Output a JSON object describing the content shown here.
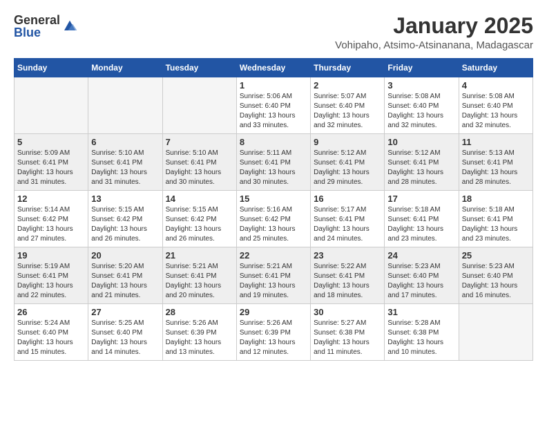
{
  "logo": {
    "general": "General",
    "blue": "Blue"
  },
  "title": "January 2025",
  "location": "Vohipaho, Atsimo-Atsinanana, Madagascar",
  "weekdays": [
    "Sunday",
    "Monday",
    "Tuesday",
    "Wednesday",
    "Thursday",
    "Friday",
    "Saturday"
  ],
  "weeks": [
    [
      {
        "day": "",
        "info": ""
      },
      {
        "day": "",
        "info": ""
      },
      {
        "day": "",
        "info": ""
      },
      {
        "day": "1",
        "info": "Sunrise: 5:06 AM\nSunset: 6:40 PM\nDaylight: 13 hours\nand 33 minutes."
      },
      {
        "day": "2",
        "info": "Sunrise: 5:07 AM\nSunset: 6:40 PM\nDaylight: 13 hours\nand 32 minutes."
      },
      {
        "day": "3",
        "info": "Sunrise: 5:08 AM\nSunset: 6:40 PM\nDaylight: 13 hours\nand 32 minutes."
      },
      {
        "day": "4",
        "info": "Sunrise: 5:08 AM\nSunset: 6:40 PM\nDaylight: 13 hours\nand 32 minutes."
      }
    ],
    [
      {
        "day": "5",
        "info": "Sunrise: 5:09 AM\nSunset: 6:41 PM\nDaylight: 13 hours\nand 31 minutes."
      },
      {
        "day": "6",
        "info": "Sunrise: 5:10 AM\nSunset: 6:41 PM\nDaylight: 13 hours\nand 31 minutes."
      },
      {
        "day": "7",
        "info": "Sunrise: 5:10 AM\nSunset: 6:41 PM\nDaylight: 13 hours\nand 30 minutes."
      },
      {
        "day": "8",
        "info": "Sunrise: 5:11 AM\nSunset: 6:41 PM\nDaylight: 13 hours\nand 30 minutes."
      },
      {
        "day": "9",
        "info": "Sunrise: 5:12 AM\nSunset: 6:41 PM\nDaylight: 13 hours\nand 29 minutes."
      },
      {
        "day": "10",
        "info": "Sunrise: 5:12 AM\nSunset: 6:41 PM\nDaylight: 13 hours\nand 28 minutes."
      },
      {
        "day": "11",
        "info": "Sunrise: 5:13 AM\nSunset: 6:41 PM\nDaylight: 13 hours\nand 28 minutes."
      }
    ],
    [
      {
        "day": "12",
        "info": "Sunrise: 5:14 AM\nSunset: 6:42 PM\nDaylight: 13 hours\nand 27 minutes."
      },
      {
        "day": "13",
        "info": "Sunrise: 5:15 AM\nSunset: 6:42 PM\nDaylight: 13 hours\nand 26 minutes."
      },
      {
        "day": "14",
        "info": "Sunrise: 5:15 AM\nSunset: 6:42 PM\nDaylight: 13 hours\nand 26 minutes."
      },
      {
        "day": "15",
        "info": "Sunrise: 5:16 AM\nSunset: 6:42 PM\nDaylight: 13 hours\nand 25 minutes."
      },
      {
        "day": "16",
        "info": "Sunrise: 5:17 AM\nSunset: 6:41 PM\nDaylight: 13 hours\nand 24 minutes."
      },
      {
        "day": "17",
        "info": "Sunrise: 5:18 AM\nSunset: 6:41 PM\nDaylight: 13 hours\nand 23 minutes."
      },
      {
        "day": "18",
        "info": "Sunrise: 5:18 AM\nSunset: 6:41 PM\nDaylight: 13 hours\nand 23 minutes."
      }
    ],
    [
      {
        "day": "19",
        "info": "Sunrise: 5:19 AM\nSunset: 6:41 PM\nDaylight: 13 hours\nand 22 minutes."
      },
      {
        "day": "20",
        "info": "Sunrise: 5:20 AM\nSunset: 6:41 PM\nDaylight: 13 hours\nand 21 minutes."
      },
      {
        "day": "21",
        "info": "Sunrise: 5:21 AM\nSunset: 6:41 PM\nDaylight: 13 hours\nand 20 minutes."
      },
      {
        "day": "22",
        "info": "Sunrise: 5:21 AM\nSunset: 6:41 PM\nDaylight: 13 hours\nand 19 minutes."
      },
      {
        "day": "23",
        "info": "Sunrise: 5:22 AM\nSunset: 6:41 PM\nDaylight: 13 hours\nand 18 minutes."
      },
      {
        "day": "24",
        "info": "Sunrise: 5:23 AM\nSunset: 6:40 PM\nDaylight: 13 hours\nand 17 minutes."
      },
      {
        "day": "25",
        "info": "Sunrise: 5:23 AM\nSunset: 6:40 PM\nDaylight: 13 hours\nand 16 minutes."
      }
    ],
    [
      {
        "day": "26",
        "info": "Sunrise: 5:24 AM\nSunset: 6:40 PM\nDaylight: 13 hours\nand 15 minutes."
      },
      {
        "day": "27",
        "info": "Sunrise: 5:25 AM\nSunset: 6:40 PM\nDaylight: 13 hours\nand 14 minutes."
      },
      {
        "day": "28",
        "info": "Sunrise: 5:26 AM\nSunset: 6:39 PM\nDaylight: 13 hours\nand 13 minutes."
      },
      {
        "day": "29",
        "info": "Sunrise: 5:26 AM\nSunset: 6:39 PM\nDaylight: 13 hours\nand 12 minutes."
      },
      {
        "day": "30",
        "info": "Sunrise: 5:27 AM\nSunset: 6:38 PM\nDaylight: 13 hours\nand 11 minutes."
      },
      {
        "day": "31",
        "info": "Sunrise: 5:28 AM\nSunset: 6:38 PM\nDaylight: 13 hours\nand 10 minutes."
      },
      {
        "day": "",
        "info": ""
      }
    ]
  ]
}
